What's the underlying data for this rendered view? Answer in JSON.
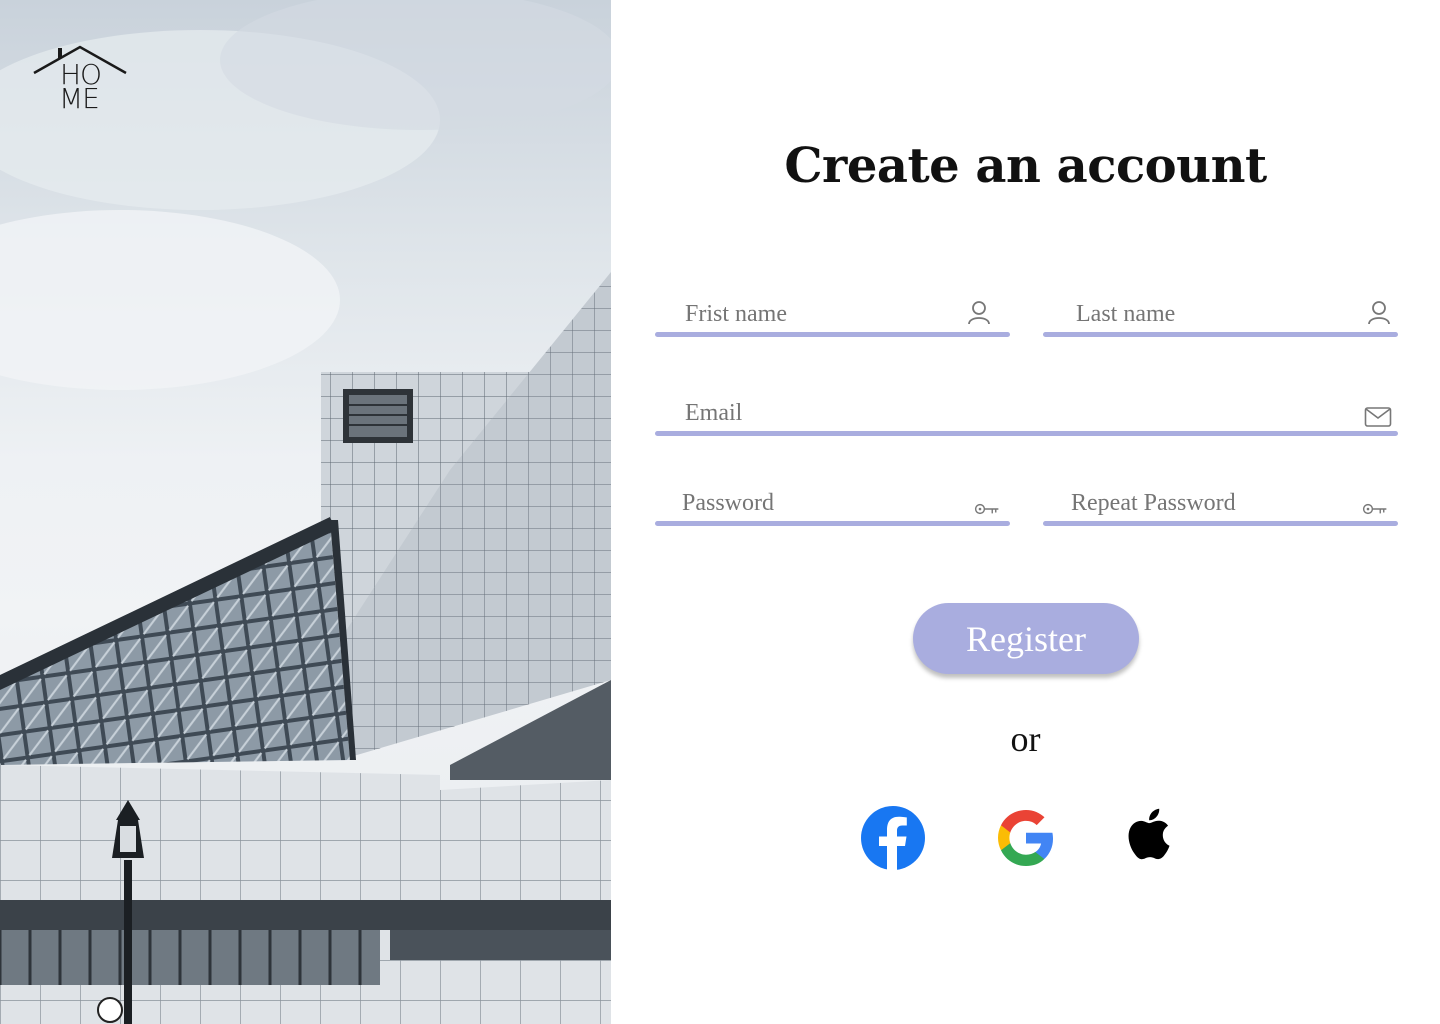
{
  "logo": {
    "line1": "HO",
    "line2": "ME"
  },
  "form": {
    "title": "Create an account",
    "first_name": {
      "placeholder": "Frist name",
      "icon": "user-icon"
    },
    "last_name": {
      "placeholder": "Last name",
      "icon": "user-icon"
    },
    "email": {
      "placeholder": "Email",
      "icon": "envelope-icon"
    },
    "password": {
      "placeholder": "Password",
      "icon": "key-icon"
    },
    "repeat_password": {
      "placeholder": "Repeat Password",
      "icon": "key-icon"
    },
    "register_label": "Register",
    "or_label": "or"
  },
  "social": [
    {
      "name": "facebook-icon"
    },
    {
      "name": "google-icon"
    },
    {
      "name": "apple-icon"
    }
  ],
  "colors": {
    "accent": "#a9addf",
    "facebook": "#1877f2",
    "text": "#111111"
  }
}
